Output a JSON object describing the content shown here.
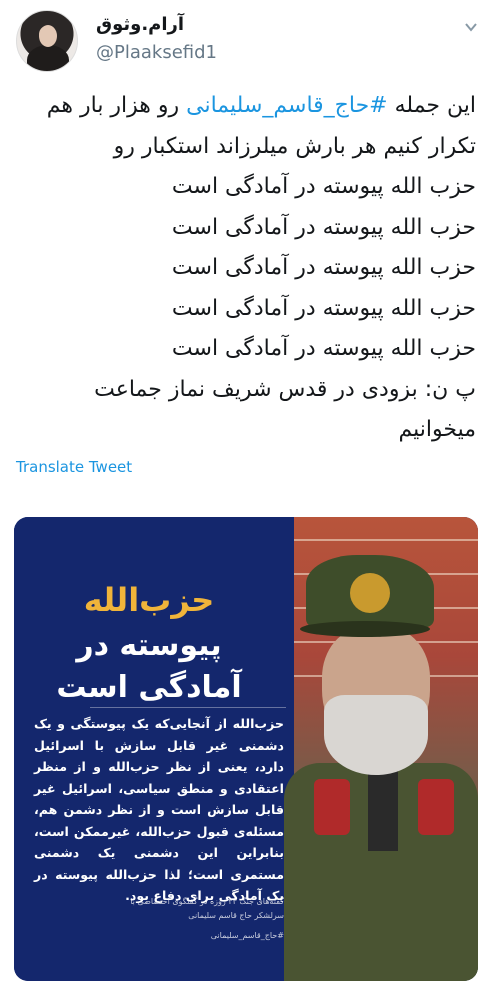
{
  "user": {
    "display_name": "آرام.وثوق",
    "handle": "@Plaaksefid1"
  },
  "tweet": {
    "line1_prefix": "این جمله ",
    "hashtag": "#حاج_قاسم_سلیمانی",
    "line1_suffix": " رو هزار بار هم",
    "line2": "تکرار کنیم  هر بارش میلرزاند استکبار رو",
    "line3": "حزب الله پیوسته در آمادگی است",
    "line4": "حزب الله پیوسته در آمادگی است",
    "line5": "حزب الله پیوسته در آمادگی است",
    "line6": "حزب الله پیوسته در آمادگی است",
    "line7": "حزب الله پیوسته در آمادگی است",
    "line8": "پ ن: بزودی در قدس شریف نماز جماعت",
    "line9": "میخوانیم"
  },
  "translate_label": "Translate Tweet",
  "media": {
    "title_accent": "حزب‌الله",
    "title_line1": "پیوسته در",
    "title_line2": "آمادگی است",
    "body": "حزب‌الله از آنجایی‌که یک پیوستگی و یک دشمنی غیر قابل سازش با اسرائیل دارد، یعنی از نظر حزب‌الله و از منظر اعتقادی و منطق سیاسی، اسرائیل غیر قابل سازش است و از نظر دشمن هم، مسئله‌ی قبول حزب‌الله، غیرممکن است، بنابراین این دشمنی یک دشمنی مستمری است؛ لذا حزب‌الله پیوسته در یک آمادگی برای دفاع بود.",
    "caption": "گفته‌های جنگ ۳۳ روزه در گفتگوی اختصاصی با سرلشکر حاج قاسم سلیمانی",
    "signature": "#حاج_قاسم_سلیمانی"
  },
  "colors": {
    "hashtag": "#1b95e0",
    "panel": "#14276d",
    "accent": "#f0b43a"
  },
  "icons": {
    "menu": "chevron-down-icon"
  }
}
